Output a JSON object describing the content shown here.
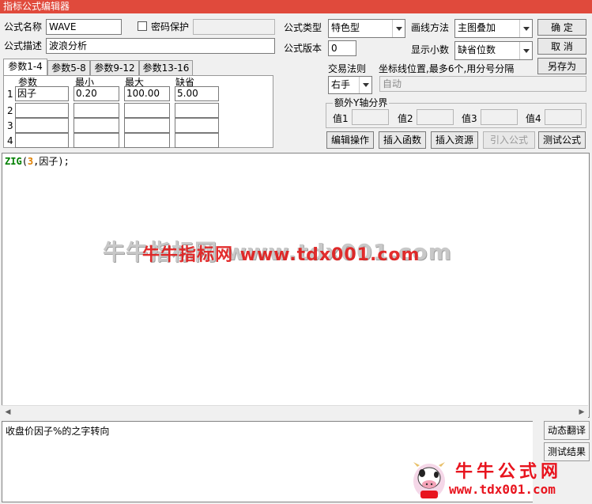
{
  "window": {
    "title": "指标公式编辑器"
  },
  "form": {
    "name_label": "公式名称",
    "name_value": "WAVE",
    "password_label": "密码保护",
    "password_value": "",
    "desc_label": "公式描述",
    "desc_value": "波浪分析",
    "type_label": "公式类型",
    "type_value": "特色型",
    "draw_label": "画线方法",
    "draw_value": "主图叠加",
    "version_label": "公式版本",
    "version_value": "0",
    "decimals_label": "显示小数",
    "decimals_value": "缺省位数",
    "trade_label": "交易法则",
    "trade_value": "右手",
    "coord_label": "坐标线位置,最多6个,用分号分隔",
    "coord_value": "自动",
    "yaxis_label": "额外Y轴分界",
    "y_values": [
      "值1",
      "值2",
      "值3",
      "值4"
    ]
  },
  "buttons": {
    "ok": "确  定",
    "cancel": "取  消",
    "save_as": "另存为",
    "edit": "编辑操作",
    "insert_func": "插入函数",
    "insert_res": "插入资源",
    "import": "引入公式",
    "test": "测试公式"
  },
  "tabs": [
    "参数1-4",
    "参数5-8",
    "参数9-12",
    "参数13-16"
  ],
  "params": {
    "headers": [
      "参数",
      "最小",
      "最大",
      "缺省"
    ],
    "rows": [
      {
        "num": "1",
        "name": "因子",
        "min": "0.20",
        "max": "100.00",
        "default": "5.00"
      },
      {
        "num": "2",
        "name": "",
        "min": "",
        "max": "",
        "default": ""
      },
      {
        "num": "3",
        "name": "",
        "min": "",
        "max": "",
        "default": ""
      },
      {
        "num": "4",
        "name": "",
        "min": "",
        "max": "",
        "default": ""
      }
    ]
  },
  "editor": {
    "code_func": "ZIG",
    "code_open": "(",
    "code_num": "3",
    "code_rest": ",因子);"
  },
  "watermark": {
    "gray": "牛牛指标网 www.tdx001.com",
    "red": "牛牛指标网 www.tdx001.com"
  },
  "bottom": {
    "text": "收盘价因子%的之字转向",
    "dynamic_translate": "动态翻译",
    "test_result": "测试结果"
  },
  "logo": {
    "title": "牛牛公式网",
    "url": "www.tdx001.com"
  },
  "colors": {
    "title_bar": "#e04a3c",
    "keyword": "#008000",
    "number": "#e08000",
    "brand_red": "#e8141e"
  }
}
